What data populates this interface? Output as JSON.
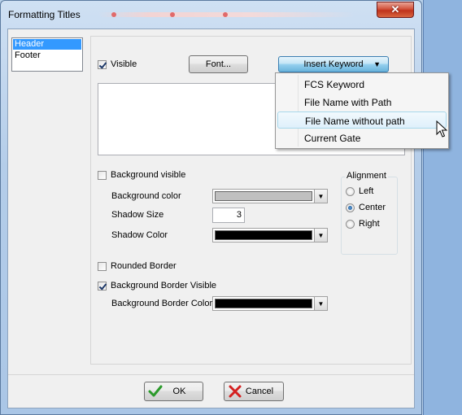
{
  "window": {
    "title": "Formatting Titles",
    "close_glyph": "✕"
  },
  "sections": {
    "items": [
      "Header",
      "Footer"
    ],
    "selected_index": 0
  },
  "visible": {
    "label": "Visible",
    "checked": true
  },
  "font_button": {
    "label": "Font..."
  },
  "insert_keyword": {
    "label": "Insert Keyword",
    "menu": [
      "FCS Keyword",
      "File Name with Path",
      "File Name without path",
      "Current Gate"
    ],
    "hovered_index": 2
  },
  "background_visible": {
    "label": "Background visible",
    "checked": false
  },
  "background_color": {
    "label": "Background color",
    "value": "#c0c0c0"
  },
  "shadow_size": {
    "label": "Shadow Size",
    "value": "3"
  },
  "shadow_color": {
    "label": "Shadow Color",
    "value": "#000000"
  },
  "alignment": {
    "title": "Alignment",
    "options": [
      "Left",
      "Center",
      "Right"
    ],
    "selected_index": 1
  },
  "rounded_border": {
    "label": "Rounded Border",
    "checked": false
  },
  "background_border_visible": {
    "label": "Background Border Visible",
    "checked": true
  },
  "background_border_color": {
    "label": "Background Border Color",
    "value": "#000000"
  },
  "buttons": {
    "ok": "OK",
    "cancel": "Cancel"
  },
  "icons": {
    "ok": "check-icon",
    "cancel": "x-icon",
    "dropdown": "chevron-down-icon",
    "cursor": "mouse-pointer-icon"
  }
}
